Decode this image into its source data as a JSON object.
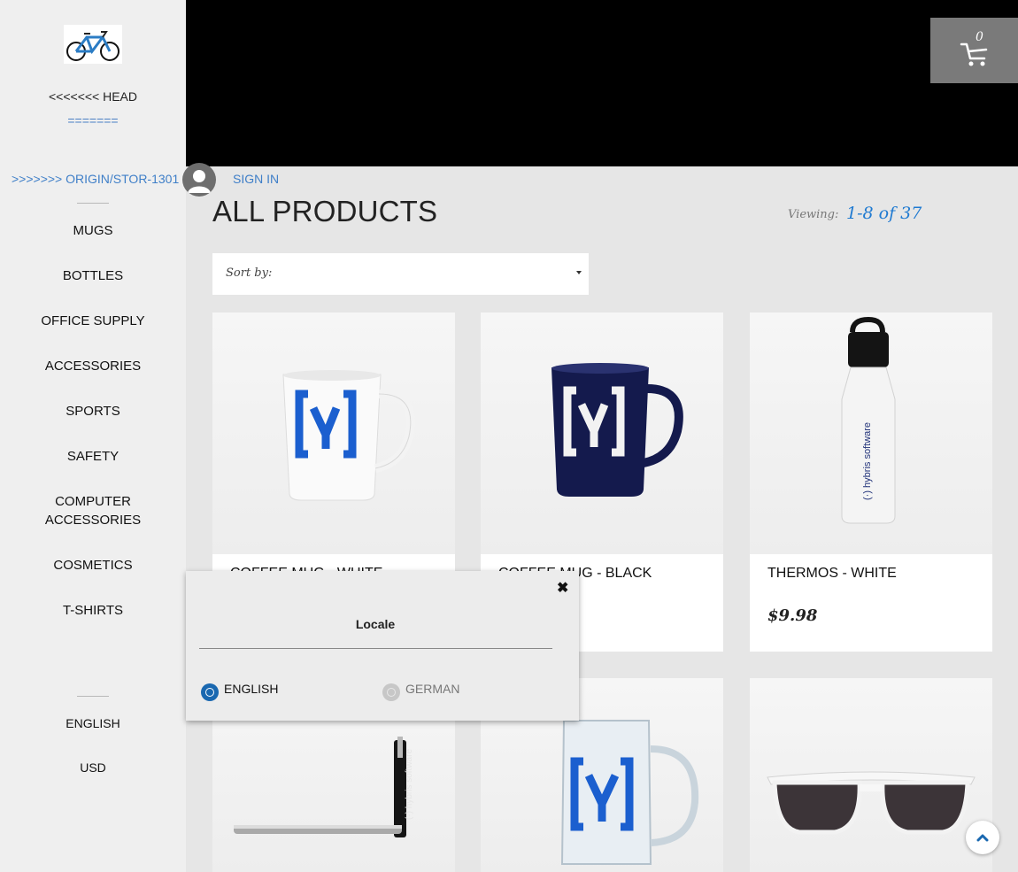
{
  "sidebar": {
    "logo_icon": "bicycle-logo",
    "head_text": "<<<<<<< HEAD",
    "separator_text": "=======",
    "origin_text": ">>>>>>> ORIGIN/STOR-1301",
    "categories": [
      {
        "label": "MUGS"
      },
      {
        "label": "BOTTLES"
      },
      {
        "label": "OFFICE SUPPLY"
      },
      {
        "label": "ACCESSORIES"
      },
      {
        "label": "SPORTS"
      },
      {
        "label": "SAFETY"
      },
      {
        "label": "COMPUTER\nACCESSORIES"
      },
      {
        "label": "COSMETICS"
      },
      {
        "label": "T-SHIRTS"
      }
    ],
    "language": "ENGLISH",
    "currency": "USD"
  },
  "header": {
    "cart_count": "0",
    "cart_icon": "cart-icon",
    "avatar_icon": "user-avatar-icon",
    "signin_label": "SIGN IN"
  },
  "main": {
    "title": "ALL PRODUCTS",
    "viewing_label": "Viewing:",
    "viewing_value": "1-8 of 37",
    "sort_label": "Sort by:",
    "products": [
      {
        "name": "COFFEE MUG - WHITE",
        "price": "",
        "image": "white-mug"
      },
      {
        "name": "COFFEE MUG - BLACK",
        "price": "",
        "image": "black-mug"
      },
      {
        "name": "THERMOS - WHITE",
        "price": "$9.98",
        "image": "white-thermos"
      },
      {
        "name": "",
        "price": "",
        "image": "pen"
      },
      {
        "name": "",
        "price": "",
        "image": "glass-mug"
      },
      {
        "name": "",
        "price": "",
        "image": "sunglasses"
      }
    ]
  },
  "locale_popup": {
    "title": "Locale",
    "close_icon": "close-icon",
    "options": [
      {
        "label": "ENGLISH",
        "selected": true
      },
      {
        "label": "GERMAN",
        "selected": false
      }
    ]
  },
  "colors": {
    "accent": "#1a68b0",
    "link": "#3f7fc8",
    "sidebar_bg": "#efefef",
    "page_bg": "#e6e6e6",
    "hero_bg": "#000000"
  }
}
